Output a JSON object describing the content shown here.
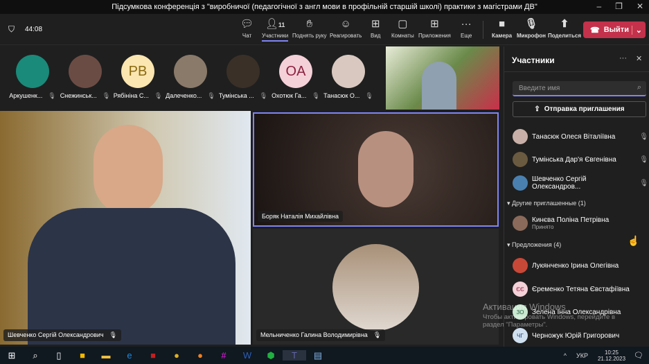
{
  "window": {
    "title": "Підсумкова конференція з \"виробничої (педагогічної з англ мови в профільній старшій школі) практики з магістрами ДВ\""
  },
  "toolbar": {
    "timer": "44:08",
    "participant_count": "11",
    "items": [
      {
        "label": "Чат",
        "icon": "chat-icon"
      },
      {
        "label": "Участники",
        "icon": "people-icon"
      },
      {
        "label": "Поднять руку",
        "icon": "hand-icon"
      },
      {
        "label": "Реагировать",
        "icon": "smile-icon"
      },
      {
        "label": "Вид",
        "icon": "grid-icon"
      },
      {
        "label": "Комнаты",
        "icon": "rooms-icon"
      },
      {
        "label": "Приложения",
        "icon": "plus-icon"
      },
      {
        "label": "Еще",
        "icon": "more-icon"
      }
    ],
    "devices": [
      {
        "label": "Камера"
      },
      {
        "label": "Микрофон"
      },
      {
        "label": "Поделиться"
      }
    ],
    "leave_label": "Выйти",
    "accent": "#c4314b"
  },
  "gallery": [
    {
      "name": "Аркушенк...",
      "bg": "#1a8a7a"
    },
    {
      "name": "Снежинськ...",
      "bg": "#6b4c44"
    },
    {
      "name": "Рябініна С...",
      "initials": "PB",
      "bg": "#fbe5b0",
      "fg": "#8a6a10"
    },
    {
      "name": "Далеченко...",
      "bg": "#8a7a6a"
    },
    {
      "name": "Тумінська ...",
      "bg": "#3a3028"
    },
    {
      "name": "Охотюк Га...",
      "initials": "OA",
      "bg": "#f4d0d8",
      "fg": "#8a2040"
    },
    {
      "name": "Танасюк О...",
      "bg": "#d8c8c0"
    }
  ],
  "videos": {
    "main": "Шевченко Сергій Олександрович",
    "speaker": "Боряк Наталія Михайлівна",
    "third": "Мельниченко Галина Володимирівна"
  },
  "sidebar": {
    "title": "Участники",
    "search_placeholder": "Введите имя",
    "invite_label": "Отправка приглашения",
    "participants": [
      {
        "name": "Танасюк Олеся Віталіївна"
      },
      {
        "name": "Тумінська Дар'я Євгенівна"
      },
      {
        "name": "Шевченко Сергій Олександров..."
      }
    ],
    "other_header": "Другие приглашенные (1)",
    "other": [
      {
        "name": "Кинєва Поліна Петрівна",
        "status": "Принято"
      }
    ],
    "suggest_header": "Предложения (4)",
    "suggestions": [
      {
        "name": "Лукянченко Ірина Олегівна"
      },
      {
        "name": "Єременко Тетяна Євстафіївна",
        "initials": "ЄЄ"
      },
      {
        "name": "Зелена Інна Олександрівна",
        "initials": "ЗО"
      },
      {
        "name": "Черножук Юрій Григорович",
        "initials": "ЧГ"
      }
    ]
  },
  "watermark": {
    "title": "Активация Windows",
    "text": "Чтобы активировать Windows, перейдите в раздел \"Параметры\"."
  },
  "taskbar": {
    "lang": "УКР",
    "time": "10:25",
    "date": "21.12.2023"
  }
}
